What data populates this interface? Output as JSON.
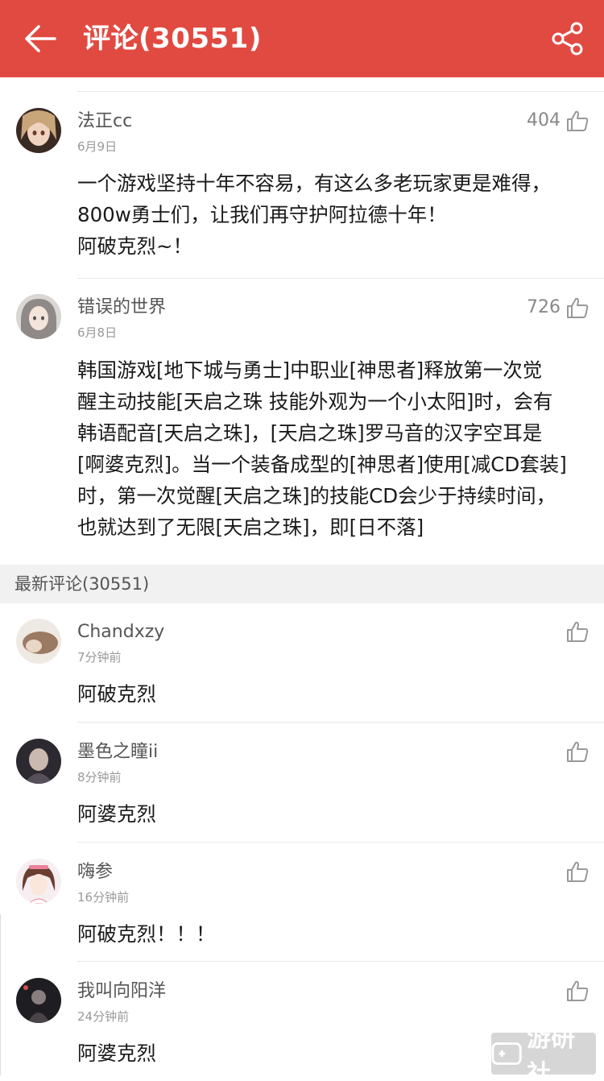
{
  "header": {
    "title": "评论(30551)",
    "back_icon": "arrow-left-icon",
    "share_icon": "share-icon",
    "bg_color": "#e14a41"
  },
  "hot_comments": [
    {
      "name": "法正cc",
      "date": "6月9日",
      "likes": "404",
      "lines": [
        "一个游戏坚持十年不容易，有这么多老玩家更是难得，",
        "800w勇士们，让我们再守护阿拉德十年！",
        "阿破克烈~！"
      ]
    },
    {
      "name": "错误的世界",
      "date": "6月8日",
      "likes": "726",
      "lines": [
        "韩国游戏[地下城与勇士]中职业[神思者]释放第一次觉",
        "醒主动技能[天启之珠 技能外观为一个小太阳]时，会有",
        "韩语配音[天启之珠]，[天启之珠]罗马音的汉字空耳是",
        "[啊婆克烈]。当一个装备成型的[神思者]使用[减CD套装]",
        "时，第一次觉醒[天启之珠]的技能CD会少于持续时间，",
        "也就达到了无限[天启之珠]，即[日不落]"
      ]
    }
  ],
  "section": {
    "title": "最新评论(30551)"
  },
  "latest_comments": [
    {
      "name": "Chandxzy",
      "time": "7分钟前",
      "text": "阿破克烈"
    },
    {
      "name": "墨色之瞳ii",
      "time": "8分钟前",
      "text": "阿婆克烈"
    },
    {
      "name": "嗨参",
      "time": "16分钟前",
      "text": "阿破克烈！！！"
    },
    {
      "name": "我叫向阳洋",
      "time": "24分钟前",
      "text": "阿婆克烈"
    }
  ],
  "watermark": {
    "text": "游研社",
    "icon": "gamepad-icon"
  }
}
